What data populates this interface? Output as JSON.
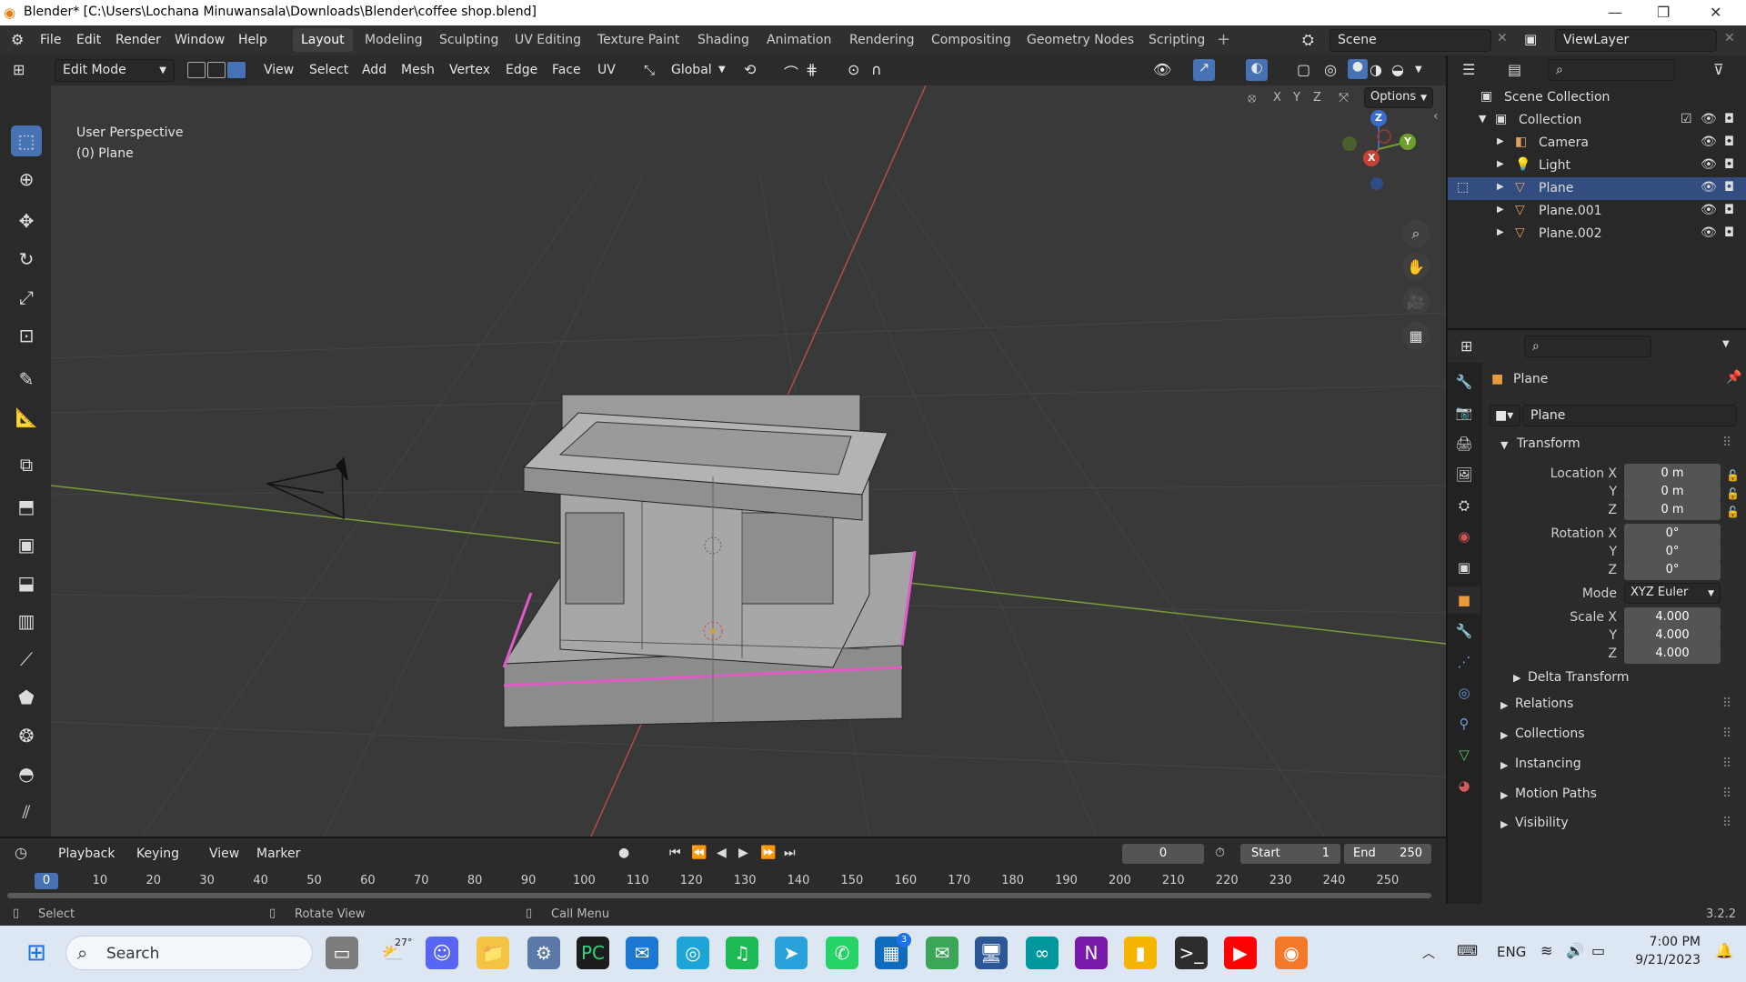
{
  "title": {
    "text": "Blender* [C:\\Users\\Lochana Minuwansala\\Downloads\\Blender\\coffee shop.blend]"
  },
  "menubar": {
    "menus": [
      "File",
      "Edit",
      "Render",
      "Window",
      "Help"
    ],
    "workspaces": [
      "Layout",
      "Modeling",
      "Sculpting",
      "UV Editing",
      "Texture Paint",
      "Shading",
      "Animation",
      "Rendering",
      "Compositing",
      "Geometry Nodes",
      "Scripting"
    ],
    "active_workspace": "Layout",
    "scene": "Scene",
    "view_layer": "ViewLayer"
  },
  "header3d": {
    "mode": "Edit Mode",
    "menus": [
      "View",
      "Select",
      "Add",
      "Mesh",
      "Vertex",
      "Edge",
      "Face",
      "UV"
    ],
    "transform_orientation": "Global",
    "axes": [
      "X",
      "Y",
      "Z"
    ],
    "options": "Options"
  },
  "viewport": {
    "perspective": "User Perspective",
    "object": "(0) Plane",
    "gizmo_axes": [
      "Z",
      "Y",
      "X"
    ],
    "colors": {
      "bg": "#393939",
      "x_axis": "#b84b4b",
      "y_axis": "#7b9a3a",
      "selected_edge": "#e05ac8"
    }
  },
  "outliner": {
    "root": "Scene Collection",
    "collection": "Collection",
    "items": [
      {
        "name": "Camera",
        "icon": "camera-icon",
        "selected": false
      },
      {
        "name": "Light",
        "icon": "light-icon",
        "selected": false
      },
      {
        "name": "Plane",
        "icon": "mesh-icon",
        "selected": true
      },
      {
        "name": "Plane.001",
        "icon": "mesh-icon",
        "selected": false
      },
      {
        "name": "Plane.002",
        "icon": "mesh-icon",
        "selected": false
      }
    ]
  },
  "properties": {
    "object_name": "Plane",
    "data_name": "Plane",
    "transform_label": "Transform",
    "location": {
      "label": "Location X",
      "x": "0 m",
      "y": "0 m",
      "z": "0 m"
    },
    "rotation": {
      "label": "Rotation X",
      "x": "0°",
      "y": "0°",
      "z": "0°"
    },
    "mode_label": "Mode",
    "mode": "XYZ Euler",
    "scale": {
      "label": "Scale X",
      "x": "4.000",
      "y": "4.000",
      "z": "4.000"
    },
    "axis_y": "Y",
    "axis_z": "Z",
    "sections": [
      "Delta Transform",
      "Relations",
      "Collections",
      "Instancing",
      "Motion Paths",
      "Visibility"
    ]
  },
  "timeline": {
    "menus": [
      "Playback",
      "Keying",
      "View",
      "Marker"
    ],
    "current_frame": "0",
    "start_label": "Start",
    "start": "1",
    "end_label": "End",
    "end": "250",
    "ruler": [
      "0",
      "10",
      "20",
      "30",
      "40",
      "50",
      "60",
      "70",
      "80",
      "90",
      "100",
      "110",
      "120",
      "130",
      "140",
      "150",
      "160",
      "170",
      "180",
      "190",
      "200",
      "210",
      "220",
      "230",
      "240",
      "250"
    ]
  },
  "statusbar": {
    "select": "Select",
    "rotate": "Rotate View",
    "call_menu": "Call Menu",
    "version": "3.2.2"
  },
  "taskbar": {
    "search": "Search",
    "weather": "27°",
    "badge": "3",
    "lang": "ENG",
    "time": "7:00 PM",
    "date": "9/21/2023"
  }
}
